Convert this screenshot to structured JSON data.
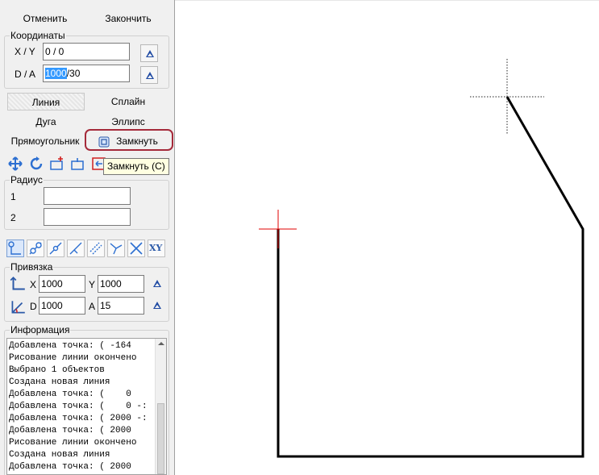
{
  "actions": {
    "cancel": "Отменить",
    "finish": "Закончить"
  },
  "coords": {
    "legend": "Координаты",
    "xy_label": "X / Y",
    "xy_value": "0 / 0",
    "da_label": "D / A",
    "da_selected": "1000",
    "da_rest": "/30"
  },
  "modes": {
    "line": "Линия",
    "spline": "Сплайн",
    "arc": "Дуга",
    "ellipse": "Эллипс",
    "rectangle": "Прямоугольник",
    "close": "Замкнуть"
  },
  "tooltip": "Замкнуть (C)",
  "radius": {
    "legend": "Радиус",
    "r1_label": "1",
    "r2_label": "2",
    "r1_value": "",
    "r2_value": ""
  },
  "snap_toolbar": {
    "xy_label": "XY"
  },
  "binding": {
    "legend": "Привязка",
    "x_label": "X",
    "x_value": "1000",
    "y_label": "Y",
    "y_value": "1000",
    "d_label": "D",
    "d_value": "1000",
    "a_label": "A",
    "a_value": "15"
  },
  "info": {
    "legend": "Информация",
    "lines": [
      "Добавлена точка: ( -164",
      "Рисование линии окончено",
      "Выбрано 1 объектов",
      "Создана новая линия",
      "Добавлена точка: (    0",
      "Добавлена точка: (    0 -:",
      "Добавлена точка: ( 2000 -:",
      "Добавлена точка: ( 2000",
      "Рисование линии окончено",
      "Создана новая линия",
      "Добавлена точка: ( 2000"
    ]
  },
  "colors": {
    "accent": "#1f4aa3",
    "highlight": "#a52a3a",
    "selection": "#3399ff",
    "cursor_red": "#e00000"
  }
}
